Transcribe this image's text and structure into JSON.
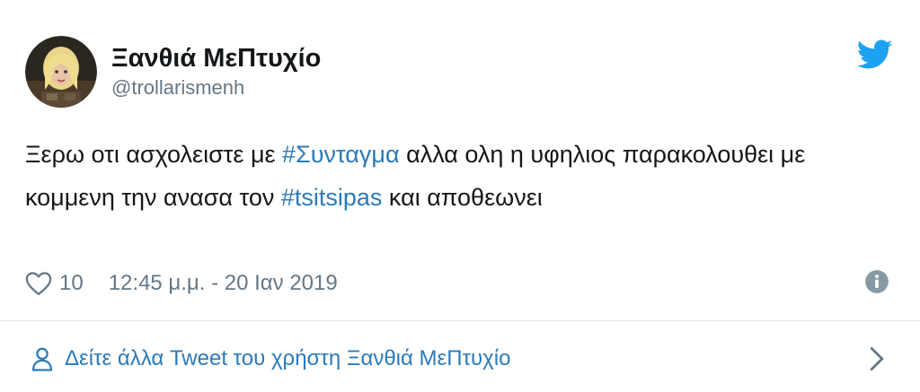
{
  "author": {
    "display_name": "Ξανθιά ΜεΠτυχίο",
    "handle": "@trollarismenh"
  },
  "tweet": {
    "text_part1": "Ξερω οτι ασχολειστε με ",
    "hashtag1": "#Συνταγμα",
    "text_part2": " αλλα ολη η υφηλιος παρακολουθει με κομμενη την ανασα τον ",
    "hashtag2": "#tsitsipas",
    "text_part3": " και αποθεωνει"
  },
  "meta": {
    "like_count": "10",
    "timestamp": "12:45 μ.μ. - 20 Ιαν 2019"
  },
  "footer": {
    "see_more_label": "Δείτε άλλα Tweet του χρήστη Ξανθιά ΜεΠτυχίο"
  },
  "icons": {
    "brand": "twitter-bird-icon",
    "like": "heart-icon",
    "info": "info-icon",
    "user": "person-icon",
    "chevron": "chevron-right-icon"
  },
  "colors": {
    "text": "#14171a",
    "secondary": "#657786",
    "link": "#2b7bb9",
    "twitter_blue": "#1da1f2",
    "divider": "#e1e8ed"
  }
}
